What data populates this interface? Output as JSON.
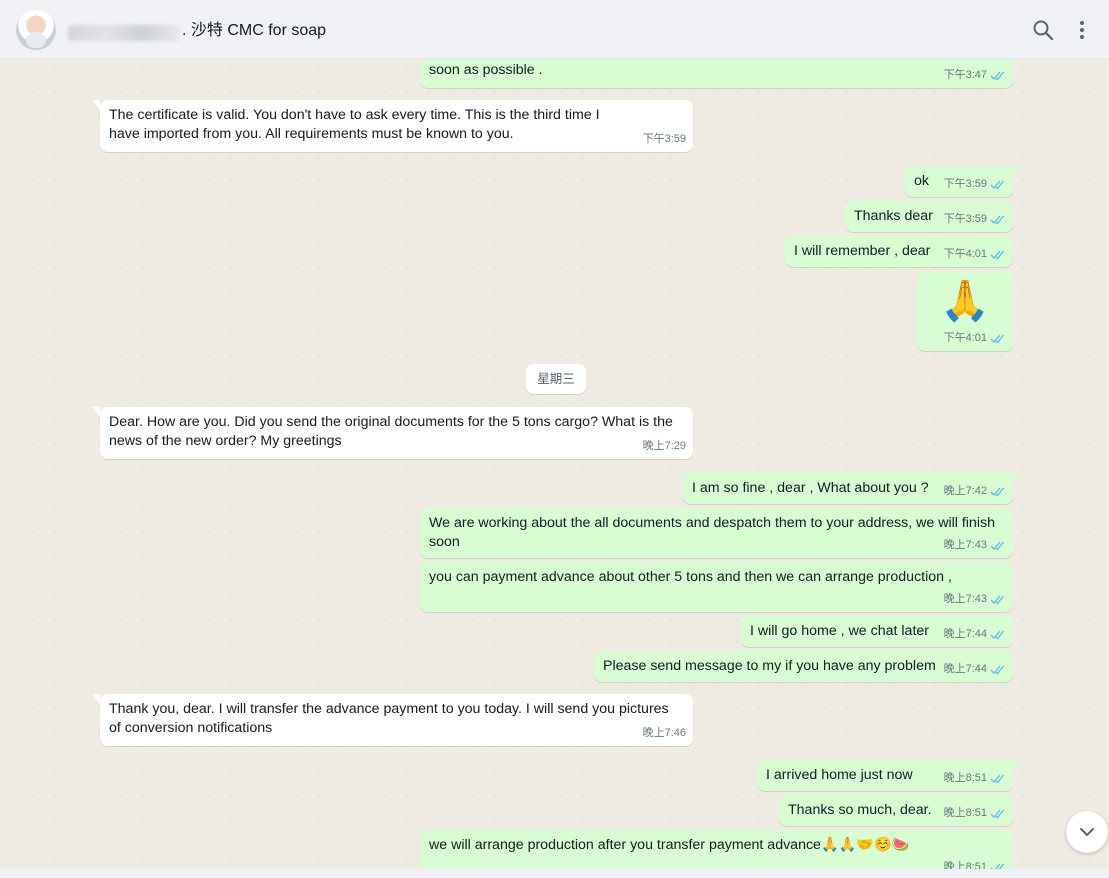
{
  "header": {
    "title": ". 沙特 CMC for soap"
  },
  "date_separator": "星期三",
  "messages": [
    {
      "text": "soon as possible .",
      "time": "下午3:47"
    },
    {
      "text": "The certificate is valid.  You don't have to ask every time.  This is the third time I have imported from you.  All requirements must be known to you.",
      "time": "下午3:59"
    },
    {
      "text": "ok",
      "time": "下午3:59"
    },
    {
      "text": "Thanks dear",
      "time": "下午3:59"
    },
    {
      "text": "I will remember , dear",
      "time": "下午4:01"
    },
    {
      "text": "🙏",
      "time": "下午4:01"
    },
    {
      "text": "Dear.  How are you.  Did you send the original documents for the 5 tons cargo?  What is the news of the new order?  My greetings",
      "time": "晚上7:29"
    },
    {
      "text": "I am so fine , dear ,  What about you ?",
      "time": "晚上7:42"
    },
    {
      "text": "We are working about the all documents and despatch them to your address, we will finish soon",
      "time": "晚上7:43"
    },
    {
      "text": "you can payment advance about other 5 tons and then we can arrange production ,",
      "time": "晚上7:43"
    },
    {
      "text": "I will go home , we chat later",
      "time": "晚上7:44"
    },
    {
      "text": "Please send message to my if you have any problem",
      "time": "晚上7:44"
    },
    {
      "text": "Thank you, dear. I will transfer the advance payment to you today.  I will send you pictures of conversion notifications",
      "time": "晚上7:46"
    },
    {
      "text": "I  arrived  home  just  now",
      "time": "晚上8:51"
    },
    {
      "text": "Thanks  so much, dear.",
      "time": "晚上8:51"
    },
    {
      "text": "we  will  arrange  production  after  you  transfer  payment advance🙏🙏🤝☺️🍉",
      "time": "晚上8:51"
    }
  ],
  "colors": {
    "outgoing_bubble": "#d9fdd3",
    "incoming_bubble": "#ffffff",
    "chat_background": "#efeae2",
    "read_ticks": "#53bdeb"
  }
}
